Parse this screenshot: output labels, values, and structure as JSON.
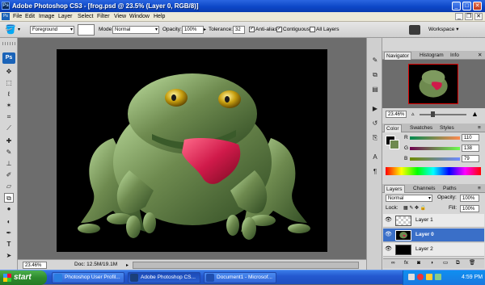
{
  "window": {
    "title": "Adobe Photoshop CS3 - [frog.psd @ 23.5% (Layer 0, RGB/8)]",
    "app_badge": "Ps"
  },
  "menu": [
    "File",
    "Edit",
    "Image",
    "Layer",
    "Select",
    "Filter",
    "View",
    "Window",
    "Help"
  ],
  "options_bar": {
    "fill_source": "Foreground",
    "mode_label": "Mode:",
    "mode_value": "Normal",
    "opacity_label": "Opacity:",
    "opacity_value": "100%",
    "tolerance_label": "Tolerance:",
    "tolerance_value": "32",
    "antialias_label": "Anti-alias",
    "antialias_checked": true,
    "contiguous_label": "Contiguous",
    "contiguous_checked": true,
    "all_layers_label": "All Layers",
    "all_layers_checked": false,
    "workspace_label": "Workspace"
  },
  "status_bar": {
    "zoom": "23.46%",
    "doc_info": "Doc: 12.5M/19.1M"
  },
  "navigator_panel": {
    "tabs": [
      "Navigator",
      "Histogram",
      "Info"
    ],
    "zoom": "23.46%"
  },
  "color_panel": {
    "tabs": [
      "Color",
      "Swatches",
      "Styles"
    ],
    "channels": [
      {
        "label": "R",
        "value": "110"
      },
      {
        "label": "G",
        "value": "138"
      },
      {
        "label": "B",
        "value": "79"
      }
    ]
  },
  "layers_panel": {
    "tabs": [
      "Layers",
      "Channels",
      "Paths"
    ],
    "blend_mode": "Normal",
    "opacity_label": "Opacity:",
    "opacity_value": "100%",
    "lock_label": "Lock:",
    "fill_label": "Fill:",
    "fill_value": "100%",
    "layers": [
      {
        "name": "Layer 1",
        "selected": false
      },
      {
        "name": "Layer 0",
        "selected": true
      },
      {
        "name": "Layer 2",
        "selected": false
      }
    ]
  },
  "taskbar": {
    "start_label": "start",
    "tasks": [
      {
        "label": "Photoshop User Profil..."
      },
      {
        "label": "Adobe Photoshop CS..."
      },
      {
        "label": "Document1 - Microsof..."
      }
    ],
    "clock": "4:59 PM"
  },
  "colors": {
    "title_bar": "#0d47c8",
    "selection": "#3a6fc8",
    "taskbar": "#2459d0",
    "start_button": "#2e8b2e",
    "frog_green": "#6e8a4f",
    "tongue": "#d01a4a"
  }
}
